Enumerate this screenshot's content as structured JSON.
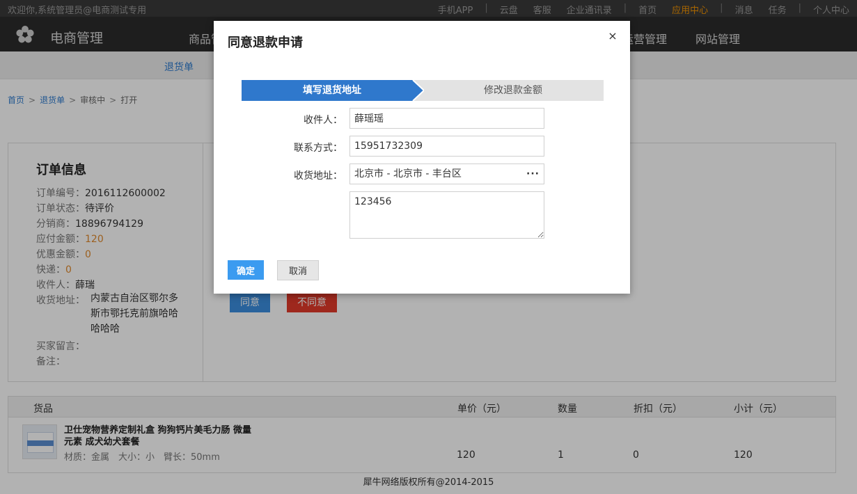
{
  "topbar": {
    "welcome": "欢迎你,系统管理员@电商测试专用",
    "links": [
      "手机APP",
      "云盘",
      "客服",
      "企业通讯录",
      "首页",
      "应用中心",
      "消息",
      "任务",
      "个人中心"
    ]
  },
  "mainnav": {
    "logo_text": "电商管理",
    "items": [
      "商品管",
      "运营管理",
      "网站管理"
    ]
  },
  "subnav": {
    "item": "退货单"
  },
  "breadcrumb": [
    "首页",
    "退货单",
    "审核中",
    "打开"
  ],
  "order": {
    "title": "订单信息",
    "order_no_label": "订单编号：",
    "order_no": "2016112600002",
    "status_label": "订单状态：",
    "status": "待评价",
    "distributor_label": "分销商：",
    "distributor": "18896794129",
    "payable_label": "应付金额：",
    "payable": "120",
    "discount_label": "优惠金额：",
    "discount": "0",
    "express_label": "快递：",
    "express": "0",
    "receiver_label": "收件人：",
    "receiver": "薛瑞",
    "address_label": "收货地址：",
    "address": "内蒙古自治区鄂尔多斯市鄂托克前旗哈哈哈哈哈",
    "message_label": "买家留言：",
    "remark_label": "备注："
  },
  "actions": {
    "agree": "同意",
    "disagree": "不同意"
  },
  "goods": {
    "headers": [
      "货品",
      "单价（元）",
      "数量",
      "折扣（元）",
      "小计（元）"
    ],
    "row": {
      "name": "卫仕宠物营养定制礼盒 狗狗钙片美毛力肠 微量元素 成犬幼犬套餐",
      "attr": "材质：金属　大小：小　臂长：50mm",
      "price": "120",
      "qty": "1",
      "discount": "0",
      "subtotal": "120"
    }
  },
  "footer": "犀牛网络版权所有@2014-2015",
  "modal": {
    "title": "同意退款申请",
    "close": "×",
    "steps": [
      "填写退货地址",
      "修改退款金额"
    ],
    "receiver_label": "收件人：",
    "receiver": "薛瑶瑶",
    "contact_label": "联系方式：",
    "contact": "15951732309",
    "address_label": "收货地址：",
    "address": "北京市 - 北京市 - 丰台区",
    "address_more": "···",
    "detail": "123456",
    "ok": "确定",
    "cancel": "取消"
  },
  "colors": {
    "primary": "#3b8fe0",
    "danger": "#e33a2a",
    "accent": "#f29300",
    "step_active": "#2f78cc"
  }
}
